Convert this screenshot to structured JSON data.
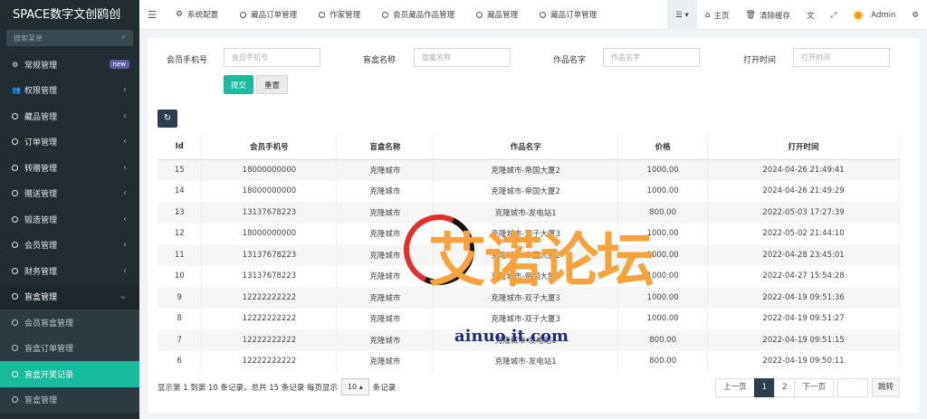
{
  "app": {
    "title": "SPACE数字文创鸥创"
  },
  "sidebar": {
    "search_placeholder": "搜索菜单",
    "items": [
      {
        "label": "常规管理",
        "badge": "new"
      },
      {
        "label": "权限管理"
      },
      {
        "label": "藏品管理"
      },
      {
        "label": "订单管理"
      },
      {
        "label": "转赠管理"
      },
      {
        "label": "赠送管理"
      },
      {
        "label": "锻造管理"
      },
      {
        "label": "会员管理"
      },
      {
        "label": "财务管理"
      },
      {
        "label": "盲盒管理"
      }
    ],
    "sub_items": [
      {
        "label": "会员盲盒管理"
      },
      {
        "label": "盲盒订单管理"
      },
      {
        "label": "盲盒开奖记录"
      },
      {
        "label": "盲盒管理"
      }
    ]
  },
  "topbar": {
    "tabs": [
      {
        "label": "系统配置",
        "icon": "gear-icon"
      },
      {
        "label": "藏品订单管理"
      },
      {
        "label": "作家管理"
      },
      {
        "label": "会员藏品作品管理"
      },
      {
        "label": "藏品管理"
      },
      {
        "label": "藏品订单管理"
      }
    ],
    "home": "主页",
    "clear_cache": "清除缓存",
    "user": "Admin"
  },
  "filters": {
    "phone_label": "会员手机号",
    "phone_placeholder": "会员手机号",
    "box_label": "盲盒名称",
    "box_placeholder": "盲盒名称",
    "work_label": "作品名字",
    "work_placeholder": "作品名字",
    "time_label": "打开时间",
    "time_placeholder": "打开时间",
    "submit": "提交",
    "reset": "重置"
  },
  "table": {
    "headers": [
      "Id",
      "会员手机号",
      "盲盒名称",
      "作品名字",
      "价格",
      "打开时间"
    ],
    "rows": [
      [
        "15",
        "18000000000",
        "克隆城市",
        "克隆城市-帝国大厦2",
        "1000.00",
        "2024-04-26 21:49:41"
      ],
      [
        "14",
        "18000000000",
        "克隆城市",
        "克隆城市-帝国大厦2",
        "1000.00",
        "2024-04-26 21:49:29"
      ],
      [
        "13",
        "13137678223",
        "克隆城市",
        "克隆城市-发电站1",
        "800.00",
        "2022-05-03 17:27:39"
      ],
      [
        "12",
        "18000000000",
        "克隆城市",
        "克隆城市-双子大厦3",
        "1000.00",
        "2022-05-02 21:44:10"
      ],
      [
        "11",
        "13137678223",
        "克隆城市",
        "克隆城市-帝国大厦2",
        "1000.00",
        "2022-04-28 23:45:01"
      ],
      [
        "10",
        "13137678223",
        "克隆城市",
        "克隆城市-帝国大厦2",
        "1000.00",
        "2022-04-27 15:54:28"
      ],
      [
        "9",
        "12222222222",
        "克隆城市",
        "克隆城市-双子大厦3",
        "1000.00",
        "2022-04-19 09:51:36"
      ],
      [
        "8",
        "12222222222",
        "克隆城市",
        "克隆城市-双子大厦3",
        "1000.00",
        "2022-04-19 09:51:27"
      ],
      [
        "7",
        "12222222222",
        "克隆城市",
        "克隆城市-发电站1",
        "800.00",
        "2022-04-19 09:51:15"
      ],
      [
        "6",
        "12222222222",
        "克隆城市",
        "克隆城市-发电站1",
        "800.00",
        "2022-04-19 09:50:11"
      ]
    ]
  },
  "footer": {
    "info_prefix": "显示第 1 到第 10 条记录，总共 15 条记录 每页显示",
    "page_size": "10",
    "info_suffix": "条记录",
    "prev": "上一页",
    "page1": "1",
    "page2": "2",
    "next": "下一页",
    "jump": "跳转"
  },
  "watermark": {
    "text": "艾诺论坛",
    "url": "ainuo.it.com"
  }
}
